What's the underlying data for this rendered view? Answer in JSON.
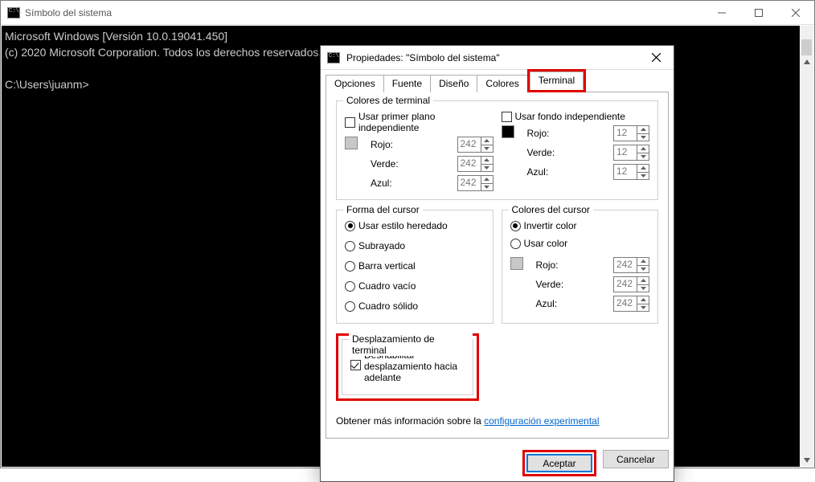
{
  "main": {
    "title": "Símbolo del sistema",
    "terminal_lines": [
      "Microsoft Windows [Versión 10.0.19041.450]",
      "(c) 2020 Microsoft Corporation. Todos los derechos reservados.",
      "",
      "C:\\Users\\juanm>"
    ]
  },
  "dialog": {
    "title": "Propiedades: \"Símbolo del sistema\"",
    "tabs": {
      "options": "Opciones",
      "font": "Fuente",
      "layout": "Diseño",
      "colors": "Colores",
      "terminal": "Terminal"
    },
    "terminalColors": {
      "group": "Colores de terminal",
      "useFg": "Usar primer plano independiente",
      "useBg": "Usar fondo independiente",
      "red": "Rojo:",
      "green": "Verde:",
      "blue": "Azul:",
      "fg_r": "242",
      "fg_g": "242",
      "fg_b": "242",
      "bg_r": "12",
      "bg_g": "12",
      "bg_b": "12"
    },
    "cursorShape": {
      "group": "Forma del cursor",
      "legacy": "Usar estilo heredado",
      "underline": "Subrayado",
      "vbar": "Barra vertical",
      "emptyBox": "Cuadro vacío",
      "solidBox": "Cuadro sólido"
    },
    "cursorColors": {
      "group": "Colores del cursor",
      "invert": "Invertir color",
      "useColor": "Usar color",
      "red": "Rojo:",
      "green": "Verde:",
      "blue": "Azul:",
      "r": "242",
      "g": "242",
      "b": "242"
    },
    "scroll": {
      "group": "Desplazamiento de terminal",
      "disable_line1": "Deshabilitar",
      "disable_line2": "desplazamiento hacia",
      "disable_line3": "adelante"
    },
    "info_prefix": "Obtener más información sobre la ",
    "info_link": "configuración experimental",
    "ok": "Aceptar",
    "cancel": "Cancelar"
  }
}
